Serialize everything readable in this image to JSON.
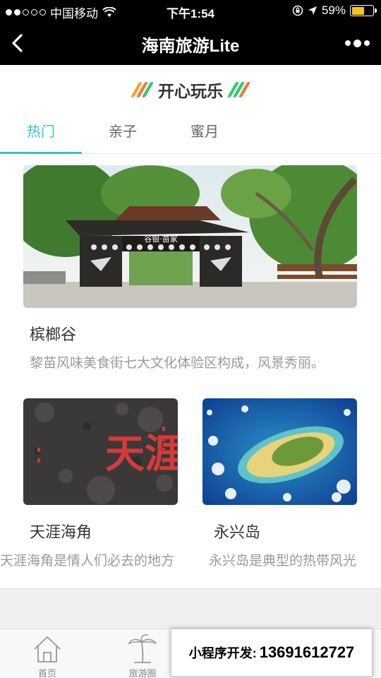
{
  "status_bar": {
    "carrier": "中国移动",
    "time": "下午1:54",
    "battery": "59%",
    "battery_level": 0.59
  },
  "nav": {
    "title": "海南旅游Lite"
  },
  "section": {
    "heading": "开心玩乐",
    "slash_colors": [
      "#f5a623",
      "#f07a3a",
      "#2ecc71"
    ]
  },
  "tabs": [
    {
      "label": "热门",
      "active": true
    },
    {
      "label": "亲子",
      "active": false
    },
    {
      "label": "蜜月",
      "active": false
    }
  ],
  "cards": [
    {
      "title": "槟榔谷",
      "desc": "黎苗风味美食街七大文化体验区构成，风景秀丽。",
      "image_sign": "谷银·苗家"
    },
    {
      "title": "天涯海角",
      "desc": "天涯海角是情人们必去的地方",
      "image_text": "天涯"
    },
    {
      "title": "永兴岛",
      "desc": "永兴岛是典型的热带风光"
    }
  ],
  "tab_bar": {
    "items": [
      {
        "label": "首页",
        "icon": "home-icon"
      },
      {
        "label": "旅游圈",
        "icon": "palm-tree-icon"
      }
    ]
  },
  "promo": {
    "label": "小程序开发:",
    "phone": "13691612727"
  },
  "colors": {
    "accent": "#3bbfce",
    "nav_bg": "#000000",
    "battery": "#f5c518"
  }
}
